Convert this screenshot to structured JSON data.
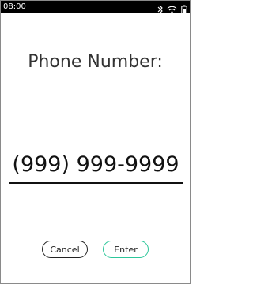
{
  "status_bar": {
    "time": "08:00",
    "icons": [
      "bluetooth-icon",
      "wifi-icon",
      "battery-icon"
    ]
  },
  "screen": {
    "title": "Phone Number:",
    "phone_value": "(999) 999-9999"
  },
  "buttons": {
    "cancel": "Cancel",
    "enter": "Enter"
  },
  "colors": {
    "status_bar_bg": "#000000",
    "status_icon": "#ffffff",
    "enter_accent": "#2cc69a",
    "text": "#333333"
  }
}
